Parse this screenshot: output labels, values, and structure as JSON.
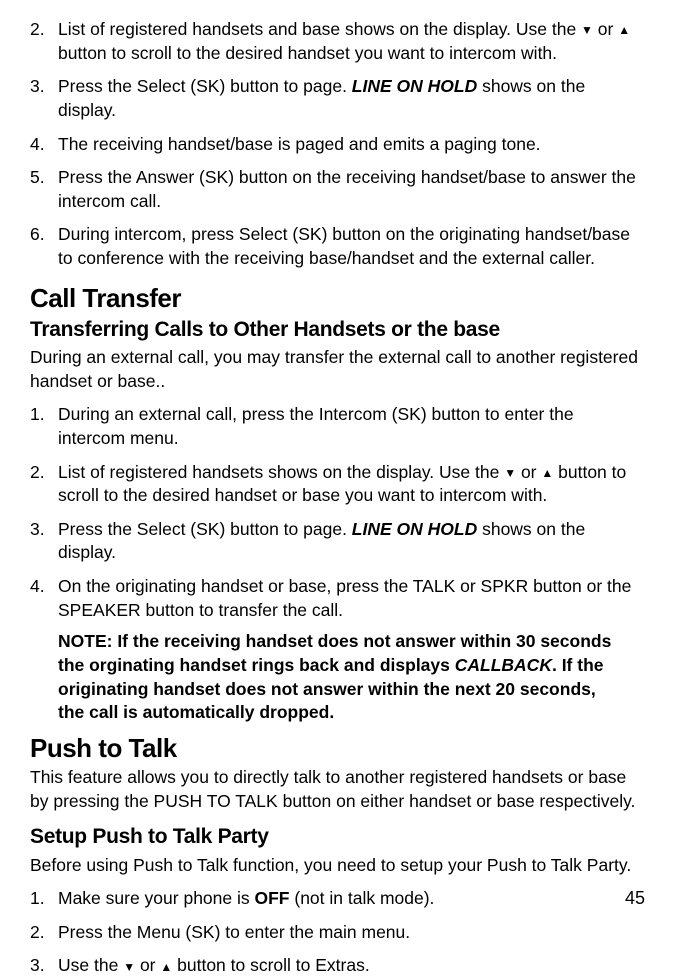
{
  "sectionA": {
    "items": [
      {
        "num": "2.",
        "pre": "List of registered handsets and base shows on the display. Use the ",
        "mid": " or ",
        "post": " button to scroll to the desired handset you want to intercom with."
      },
      {
        "num": "3.",
        "pre": "Press the ",
        "sk": "Select (SK)",
        "mid": " button to page. ",
        "hold": "LINE ON HOLD",
        "post": " shows on the display."
      },
      {
        "num": "4.",
        "text": "The receiving handset/base is paged and emits a paging tone."
      },
      {
        "num": "5.",
        "pre": "Press the ",
        "sk": "Answer (SK)",
        "post": " button on the receiving handset/base to answer the intercom call."
      },
      {
        "num": "6.",
        "pre": "During intercom, press ",
        "sk": "Select (SK)",
        "post": " button on the originating handset/base to conference with the receiving base/handset and the external caller."
      }
    ]
  },
  "callTransfer": {
    "title": "Call Transfer",
    "subtitle": "Transferring Calls to Other Handsets or the base",
    "intro": "During an external call, you may transfer the external call to another registered handset or base..",
    "items": [
      {
        "num": "1.",
        "pre": "During an external call, press the ",
        "sk": "Intercom (SK)",
        "post": " button to enter the intercom menu."
      },
      {
        "num": "2.",
        "pre": "List of registered handsets shows on the display. Use the ",
        "mid": " or ",
        "post": " button to scroll to the desired handset or base you want to intercom with."
      },
      {
        "num": "3.",
        "pre": "Press the ",
        "sk": "Select (SK)",
        "mid": " button to page. ",
        "hold": "LINE ON HOLD",
        "post": " shows on the display."
      },
      {
        "num": "4.",
        "pre": "On the originating handset or base, press the ",
        "caps1": "TALK",
        "mid1": " or ",
        "caps2": "SPKR",
        "mid2": " button or the ",
        "caps3": "SPEAKER",
        "post": " button to transfer the call."
      }
    ],
    "noteLabel": "NOTE:",
    "noteText1": " If the receiving handset does not answer within 30 seconds the orginating handset rings back and displays ",
    "noteUni": "CALLBACK",
    "noteText2": ". If the originating handset does not answer within the next 20 seconds, the call is automatically dropped."
  },
  "pushToTalk": {
    "title": "Push to Talk",
    "intro1": "This feature allows you to directly talk to another registered handsets or base by pressing the ",
    "caps": "PUSH TO TALK",
    "intro2": " button on either handset or base respectively.",
    "subtitle": "Setup Push to Talk Party",
    "intro3": "Before using Push to Talk function, you need to setup your Push to Talk Party.",
    "items": [
      {
        "num": "1.",
        "pre": "Make sure your phone is ",
        "bold": "OFF",
        "post": " (not in talk mode)."
      },
      {
        "num": "2.",
        "pre": "Press the ",
        "sk": "Menu (SK)",
        "post": " to enter the main menu."
      },
      {
        "num": "3.",
        "pre": "Use the ",
        "mid": " or ",
        "post": " button to scroll to Extras."
      }
    ]
  },
  "pageNum": "45",
  "arrows": {
    "down": "▼",
    "up": "▲"
  }
}
